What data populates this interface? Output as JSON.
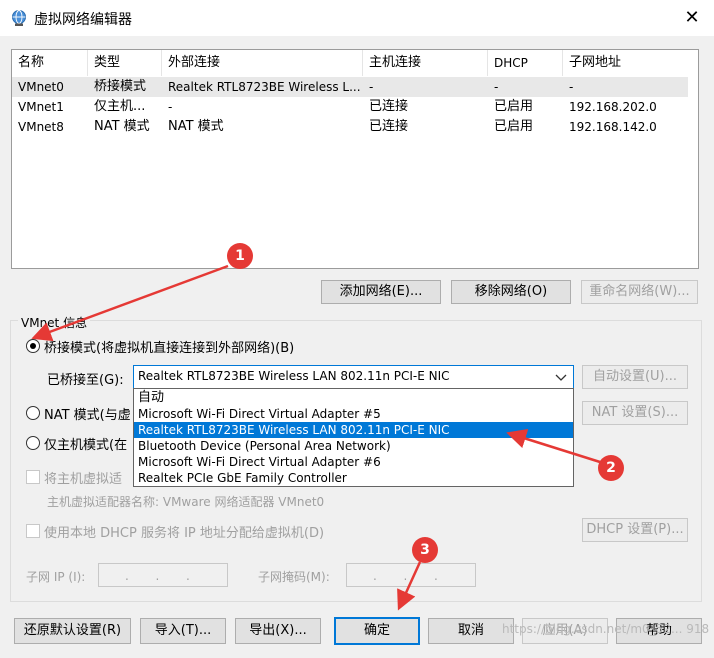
{
  "window": {
    "title": "虚拟网络编辑器",
    "close_symbol": "✕"
  },
  "table": {
    "headers": [
      "名称",
      "类型",
      "外部连接",
      "主机连接",
      "DHCP",
      "子网地址"
    ],
    "rows": [
      [
        "VMnet0",
        "桥接模式",
        "Realtek RTL8723BE Wireless L...",
        "-",
        "-",
        "-"
      ],
      [
        "VMnet1",
        "仅主机...",
        "-",
        "已连接",
        "已启用",
        "192.168.202.0"
      ],
      [
        "VMnet8",
        "NAT 模式",
        "NAT 模式",
        "已连接",
        "已启用",
        "192.168.142.0"
      ]
    ]
  },
  "network_buttons": {
    "add": "添加网络(E)...",
    "remove": "移除网络(O)",
    "rename": "重命名网络(W)..."
  },
  "vmnet_info": {
    "group_label": "VMnet 信息",
    "bridge_radio": "桥接模式(将虚拟机直接连接到外部网络)(B)",
    "bridged_to_label": "已桥接至(G):",
    "bridged_to_value": "Realtek RTL8723BE Wireless LAN 802.11n PCI-E NIC",
    "auto_settings": "自动设置(U)...",
    "nat_radio": "NAT 模式(与虚",
    "nat_settings": "NAT 设置(S)...",
    "hostonly_radio": "仅主机模式(在",
    "connect_host_adapter": "将主机虚拟适",
    "host_adapter_name": "主机虚拟适配器名称: VMware 网络适配器 VMnet0",
    "use_dhcp": "使用本地 DHCP 服务将 IP 地址分配给虚拟机(D)",
    "dhcp_settings": "DHCP 设置(P)...",
    "subnet_ip_label": "子网 IP (I):",
    "subnet_mask_label": "子网掩码(M):",
    "ip_dots": ".       .       ."
  },
  "dropdown": {
    "options": [
      "自动",
      "Microsoft Wi-Fi Direct Virtual Adapter #5",
      "Realtek RTL8723BE Wireless LAN 802.11n PCI-E NIC",
      "Bluetooth Device (Personal Area Network)",
      "Microsoft Wi-Fi Direct Virtual Adapter #6",
      "Realtek PCIe GbE Family Controller"
    ],
    "selected_index": 2
  },
  "bottom_buttons": {
    "restore": "还原默认设置(R)",
    "import": "导入(T)...",
    "export": "导出(X)...",
    "ok": "确定",
    "cancel": "取消",
    "apply": "应用(A)",
    "help": "帮助"
  },
  "annotations": [
    "1",
    "2",
    "3"
  ],
  "watermark": "https://blog.csdn.net/m0_52... 918",
  "colors": {
    "accent": "#0078d7",
    "annotation_red": "#e53935"
  },
  "icons": {
    "app": "network-globe-icon",
    "dropdown": "chevron-down-icon"
  }
}
